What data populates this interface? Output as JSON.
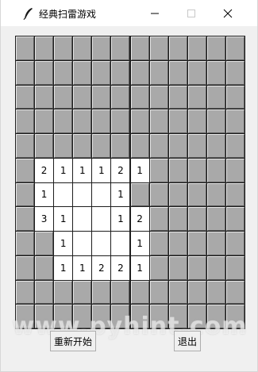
{
  "window": {
    "title": "经典扫雷游戏",
    "icon": "feather-icon",
    "controls": [
      "minimize-icon",
      "maximize-icon",
      "close-icon"
    ]
  },
  "board": {
    "rows": 12,
    "cols": 12,
    "grid": [
      [
        "#",
        "#",
        "#",
        "#",
        "#",
        "#",
        "#",
        "#",
        "#",
        "#",
        "#",
        "#"
      ],
      [
        "#",
        "#",
        "#",
        "#",
        "#",
        "#",
        "#",
        "#",
        "#",
        "#",
        "#",
        "#"
      ],
      [
        "#",
        "#",
        "#",
        "#",
        "#",
        "#",
        "#",
        "#",
        "#",
        "#",
        "#",
        "#"
      ],
      [
        "#",
        "#",
        "#",
        "#",
        "#",
        "#",
        "#",
        "#",
        "#",
        "#",
        "#",
        "#"
      ],
      [
        "#",
        "#",
        "#",
        "#",
        "#",
        "#",
        "#",
        "#",
        "#",
        "#",
        "#",
        "#"
      ],
      [
        "#",
        "2",
        "1",
        "1",
        "1",
        "2",
        "1",
        "#",
        "#",
        "#",
        "#",
        "#"
      ],
      [
        "#",
        "1",
        "",
        "",
        "",
        "1",
        "#",
        "#",
        "#",
        "#",
        "#",
        "#"
      ],
      [
        "#",
        "3",
        "1",
        "",
        "",
        "1",
        "2",
        "#",
        "#",
        "#",
        "#",
        "#"
      ],
      [
        "#",
        "#",
        "1",
        "",
        "",
        "",
        "1",
        "#",
        "#",
        "#",
        "#",
        "#"
      ],
      [
        "#",
        "#",
        "1",
        "1",
        "2",
        "2",
        "1",
        "#",
        "#",
        "#",
        "#",
        "#"
      ],
      [
        "#",
        "#",
        "#",
        "#",
        "#",
        "#",
        "#",
        "#",
        "#",
        "#",
        "#",
        "#"
      ],
      [
        "#",
        "#",
        "#",
        "#",
        "#",
        "#",
        "#",
        "#",
        "#",
        "#",
        "#",
        "#"
      ]
    ],
    "colors": {
      "hidden": "#a9a9a9",
      "open": "#ffffff",
      "gridline": "#1e1e1e"
    }
  },
  "buttons": {
    "restart_label": "重新开始",
    "quit_label": "退出"
  },
  "watermark": "www.pyhint.com"
}
